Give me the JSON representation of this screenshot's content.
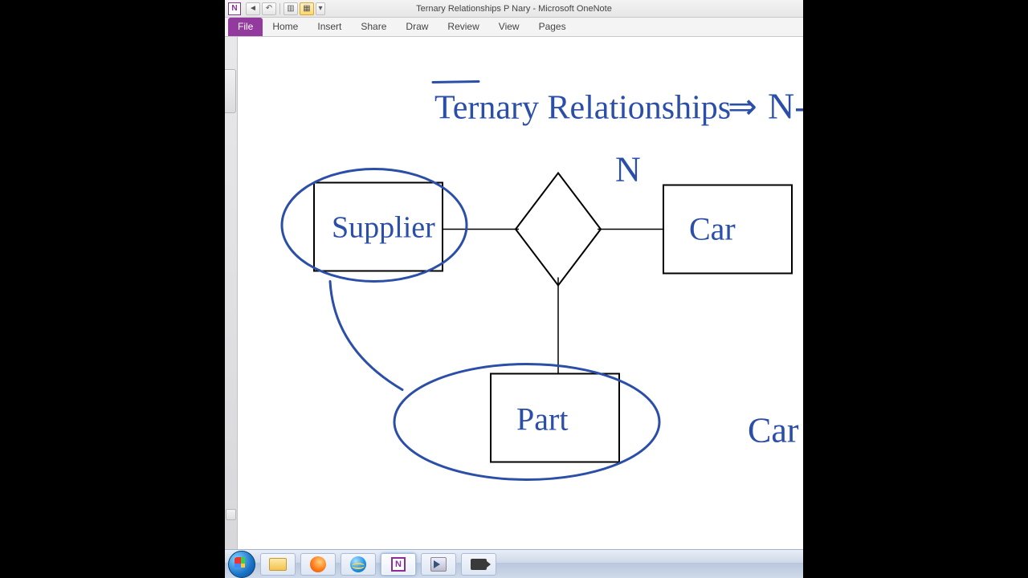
{
  "window": {
    "title": "Ternary Relationships P Nary  -  Microsoft OneNote",
    "app_icon_letter": "N"
  },
  "qat": {
    "back_glyph": "◄",
    "undo_glyph": "↶",
    "layout_glyph": "▥",
    "select_glyph": "▦",
    "more_glyph": "▾"
  },
  "ribbon": {
    "file": "File",
    "tabs": [
      "Home",
      "Insert",
      "Share",
      "Draw",
      "Review",
      "View",
      "Pages"
    ]
  },
  "diagram": {
    "title_text": "Ternary Relationships",
    "arrow_glyph": "⇒",
    "n_right": "N-",
    "n_top": "N",
    "entities": {
      "supplier": "Supplier",
      "car": "Car",
      "part": "Part"
    },
    "side_text": "Car"
  },
  "scroll": {
    "left_glyph": "◄",
    "right_glyph": "►"
  },
  "taskbar": {
    "onenote_letter": "N"
  }
}
